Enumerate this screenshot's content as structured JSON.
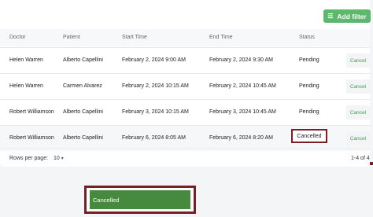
{
  "toolbar": {
    "add_filter_label": "Add filter",
    "add_filter_icon": "filter-icon"
  },
  "table": {
    "columns": [
      "Doctor",
      "Patient",
      "Start Time",
      "End Time",
      "Status"
    ],
    "rows": [
      {
        "doctor": "Helen Warren",
        "patient": "Alberto Capellini",
        "start": "February 2, 2024 9:00 AM",
        "end": "February 2, 2024 9:30 AM",
        "status": "Pending",
        "action": "Cancel"
      },
      {
        "doctor": "Helen Warren",
        "patient": "Carmen Alvarez",
        "start": "February 2, 2024 10:15 AM",
        "end": "February 2, 2024 10:45 AM",
        "status": "Pending",
        "action": "Cancel"
      },
      {
        "doctor": "Robert Williamson",
        "patient": "Alberto Capellini",
        "start": "February 3, 2024 10:15 AM",
        "end": "February 3, 2024 10:45 AM",
        "status": "Pending",
        "action": "Cancel"
      },
      {
        "doctor": "Robert Williamson",
        "patient": "Alberto Capellini",
        "start": "February 6, 2024 8:05 AM",
        "end": "February 6, 2024 8:20 AM",
        "status": "Cancelled",
        "action": "Cancel"
      }
    ]
  },
  "pagination": {
    "rows_per_page_label": "Rows per page:",
    "rows_per_page_value": "10",
    "range_label": "1-4 of 4"
  },
  "toast": {
    "message": "Cancelled"
  },
  "colors": {
    "accent_green": "#5cb86c",
    "toast_green": "#458a3d",
    "annotation_red": "#7a1f23"
  }
}
